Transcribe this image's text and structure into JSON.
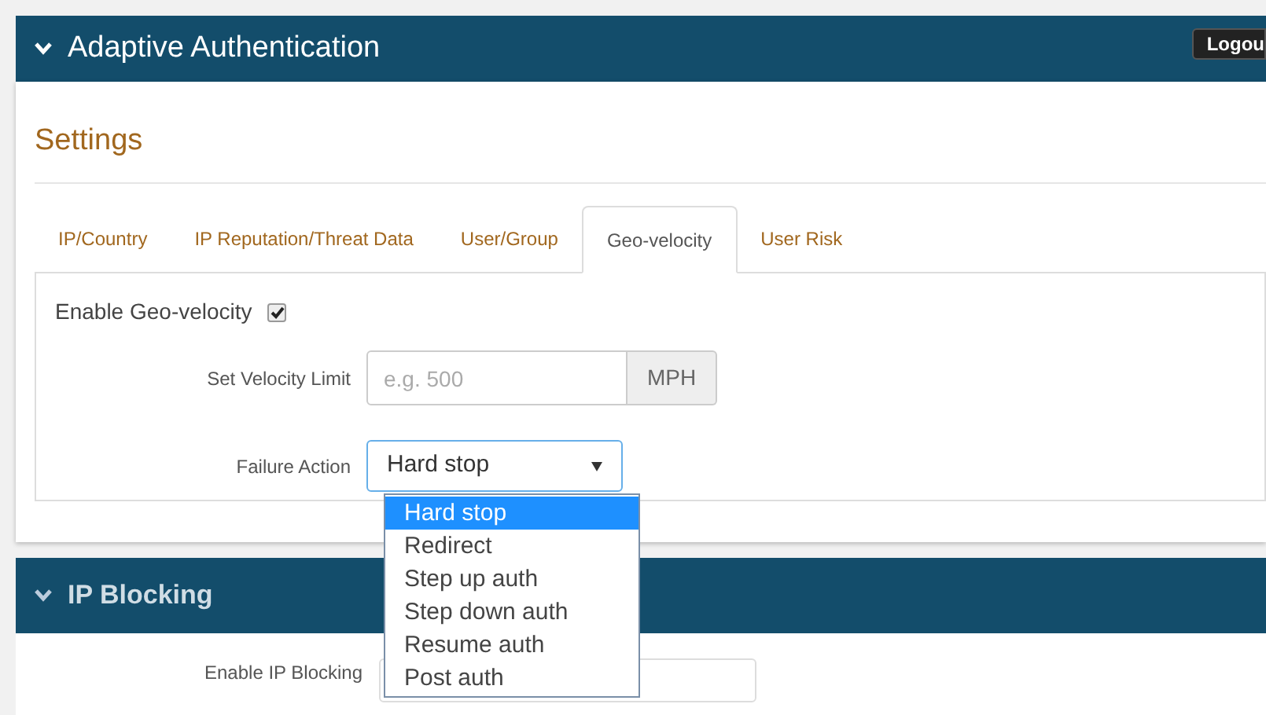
{
  "header": {
    "title": "Adaptive Authentication",
    "logout": "Logou"
  },
  "settings": {
    "title": "Settings",
    "tabs": [
      {
        "label": "IP/Country",
        "selected": false
      },
      {
        "label": "IP Reputation/Threat Data",
        "selected": false
      },
      {
        "label": "User/Group",
        "selected": false
      },
      {
        "label": "Geo-velocity",
        "selected": true
      },
      {
        "label": "User Risk",
        "selected": false
      }
    ],
    "enable": {
      "label": "Enable Geo-velocity",
      "checked": true
    },
    "velocity": {
      "label": "Set Velocity Limit",
      "placeholder": "e.g. 500",
      "unit": "MPH"
    },
    "failure": {
      "label": "Failure Action",
      "value": "Hard stop",
      "expanded": true,
      "options": [
        {
          "label": "Hard stop",
          "selected": true
        },
        {
          "label": "Redirect",
          "selected": false
        },
        {
          "label": "Step up auth",
          "selected": false
        },
        {
          "label": "Step down auth",
          "selected": false
        },
        {
          "label": "Resume auth",
          "selected": false
        },
        {
          "label": "Post auth",
          "selected": false
        }
      ]
    }
  },
  "ip_blocking": {
    "title": "IP Blocking",
    "field_label": "Enable IP Blocking"
  }
}
